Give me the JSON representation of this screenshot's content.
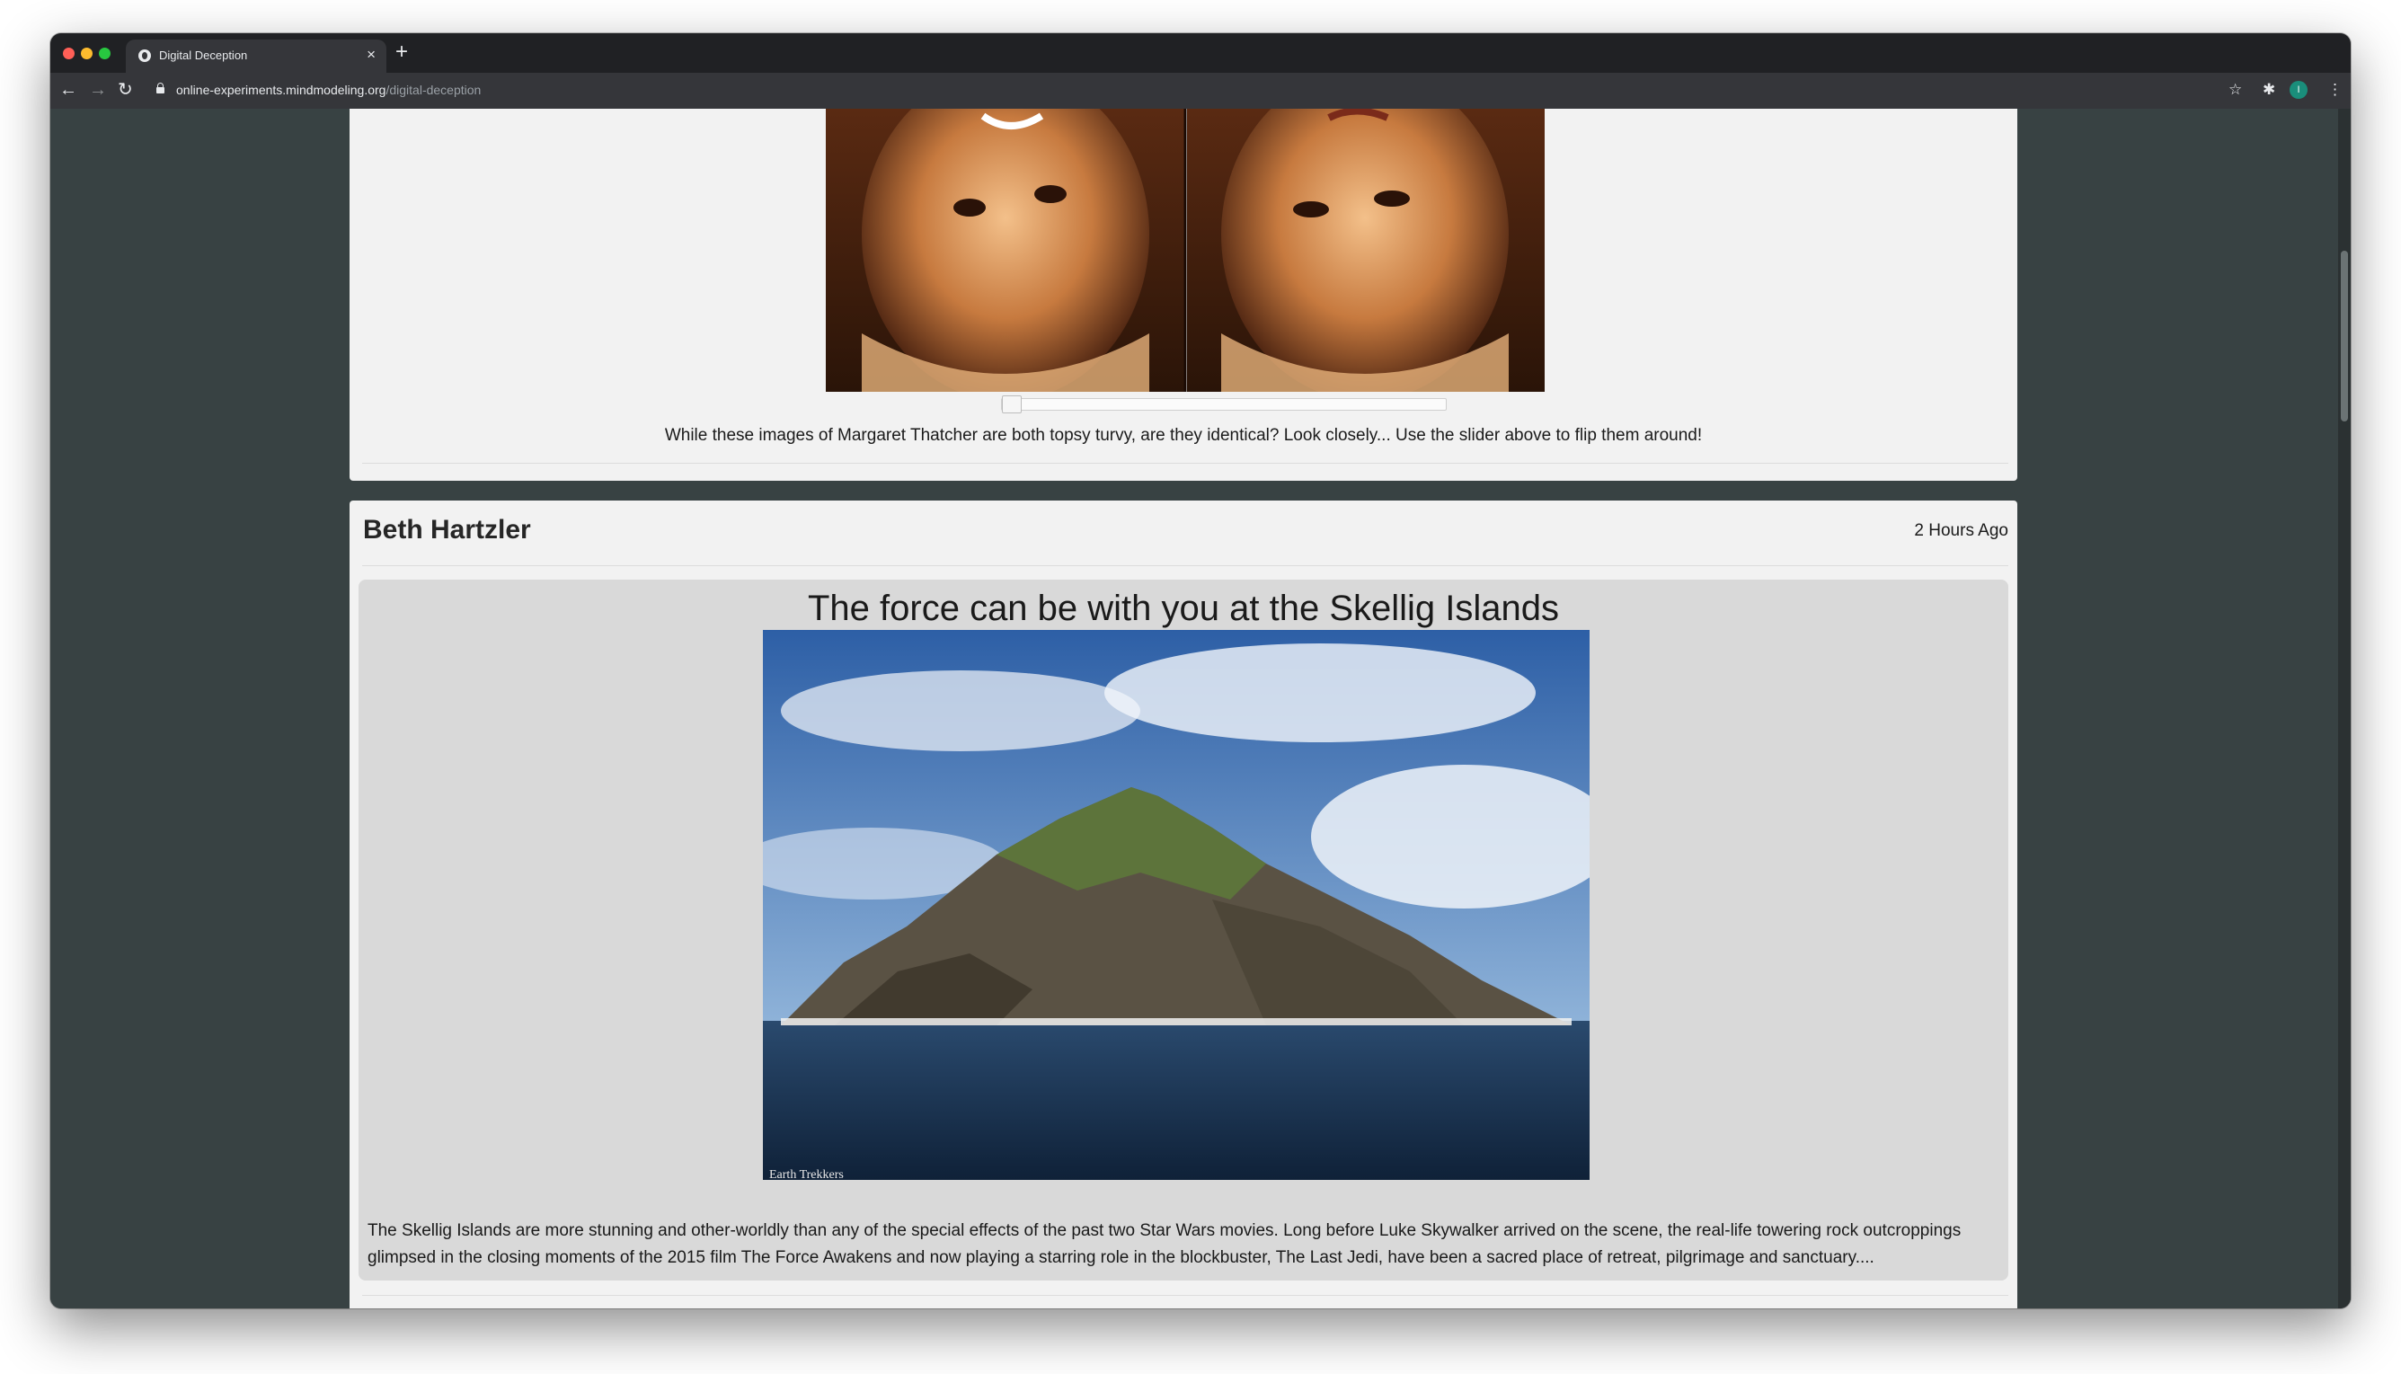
{
  "browser": {
    "tab_title": "Digital Deception",
    "tab_close": "×",
    "new_tab": "+",
    "url_domain": "online-experiments.mindmodeling.org",
    "url_path": "/digital-deception",
    "back_icon": "←",
    "forward_icon": "→",
    "reload_icon": "↻",
    "star_icon": "☆",
    "extensions_icon": "✱",
    "profile_initial": "I",
    "menu_icon": "⋮"
  },
  "post1": {
    "caption": "While these images of Margaret Thatcher are both topsy turvy, are they identical? Look closely... Use the slider above to flip them around!",
    "slider_value": 0
  },
  "post2": {
    "author": "Beth Hartzler",
    "time": "2 Hours Ago",
    "title": "The force can be with you at the Skellig Islands",
    "image_watermark": "Earth Trekkers",
    "body": "The Skellig Islands are more stunning and other-worldly than any of the special effects of the past two Star Wars movies. Long before Luke Skywalker arrived on the scene, the real-life towering rock outcroppings glimpsed in the closing moments of the 2015 film The Force Awakens and now playing a starring role in the blockbuster, The Last Jedi, have been a sacred place of retreat, pilgrimage and sanctuary...."
  },
  "colors": {
    "page_background": "#384243",
    "card_background": "#f2f2f2",
    "post_background": "#d9d9d9"
  }
}
